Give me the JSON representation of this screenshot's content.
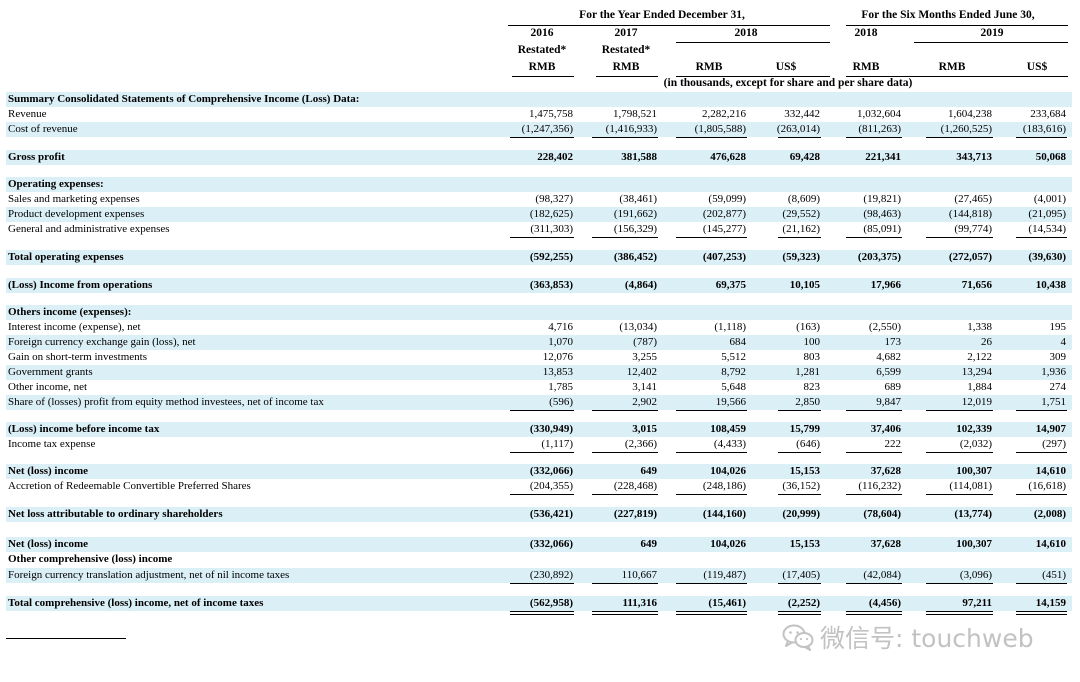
{
  "header": {
    "year_group": "For the Year Ended December 31,",
    "six_month_group": "For the Six Months Ended June 30,",
    "years": [
      "2016",
      "2017",
      "2018",
      "2018",
      "2019"
    ],
    "restated": [
      "Restated*",
      "Restated*"
    ],
    "currencies": [
      "RMB",
      "RMB",
      "RMB",
      "US$",
      "RMB",
      "RMB",
      "US$"
    ],
    "units_note": "(in thousands, except for share and per share data)"
  },
  "rows": [
    {
      "label": "Summary Consolidated Statements of Comprehensive Income (Loss) Data:",
      "values": [
        "",
        "",
        "",
        "",
        "",
        "",
        ""
      ]
    },
    {
      "label": "Revenue",
      "values": [
        "1,475,758",
        "1,798,521",
        "2,282,216",
        "332,442",
        "1,032,604",
        "1,604,238",
        "233,684"
      ]
    },
    {
      "label": "Cost of revenue",
      "values": [
        "(1,247,356)",
        "(1,416,933)",
        "(1,805,588)",
        "(263,014)",
        "(811,263)",
        "(1,260,525)",
        "(183,616)"
      ]
    },
    {
      "label": "Gross profit",
      "values": [
        "228,402",
        "381,588",
        "476,628",
        "69,428",
        "221,341",
        "343,713",
        "50,068"
      ]
    },
    {
      "label": "Operating expenses:",
      "values": [
        "",
        "",
        "",
        "",
        "",
        "",
        ""
      ]
    },
    {
      "label": "Sales and marketing expenses",
      "values": [
        "(98,327)",
        "(38,461)",
        "(59,099)",
        "(8,609)",
        "(19,821)",
        "(27,465)",
        "(4,001)"
      ]
    },
    {
      "label": "Product development expenses",
      "values": [
        "(182,625)",
        "(191,662)",
        "(202,877)",
        "(29,552)",
        "(98,463)",
        "(144,818)",
        "(21,095)"
      ]
    },
    {
      "label": "General and administrative expenses",
      "values": [
        "(311,303)",
        "(156,329)",
        "(145,277)",
        "(21,162)",
        "(85,091)",
        "(99,774)",
        "(14,534)"
      ]
    },
    {
      "label": "Total operating expenses",
      "values": [
        "(592,255)",
        "(386,452)",
        "(407,253)",
        "(59,323)",
        "(203,375)",
        "(272,057)",
        "(39,630)"
      ]
    },
    {
      "label": "(Loss) Income from operations",
      "values": [
        "(363,853)",
        "(4,864)",
        "69,375",
        "10,105",
        "17,966",
        "71,656",
        "10,438"
      ]
    },
    {
      "label": "Others income (expenses):",
      "values": [
        "",
        "",
        "",
        "",
        "",
        "",
        ""
      ]
    },
    {
      "label": "Interest income (expense), net",
      "values": [
        "4,716",
        "(13,034)",
        "(1,118)",
        "(163)",
        "(2,550)",
        "1,338",
        "195"
      ]
    },
    {
      "label": "Foreign currency exchange gain (loss), net",
      "values": [
        "1,070",
        "(787)",
        "684",
        "100",
        "173",
        "26",
        "4"
      ]
    },
    {
      "label": "Gain on short-term investments",
      "values": [
        "12,076",
        "3,255",
        "5,512",
        "803",
        "4,682",
        "2,122",
        "309"
      ]
    },
    {
      "label": "Government grants",
      "values": [
        "13,853",
        "12,402",
        "8,792",
        "1,281",
        "6,599",
        "13,294",
        "1,936"
      ]
    },
    {
      "label": "Other income, net",
      "values": [
        "1,785",
        "3,141",
        "5,648",
        "823",
        "689",
        "1,884",
        "274"
      ]
    },
    {
      "label": "Share of (losses) profit from equity method investees, net of income tax",
      "values": [
        "(596)",
        "2,902",
        "19,566",
        "2,850",
        "9,847",
        "12,019",
        "1,751"
      ]
    },
    {
      "label": "(Loss) income before income tax",
      "values": [
        "(330,949)",
        "3,015",
        "108,459",
        "15,799",
        "37,406",
        "102,339",
        "14,907"
      ]
    },
    {
      "label": "Income tax expense",
      "values": [
        "(1,117)",
        "(2,366)",
        "(4,433)",
        "(646)",
        "222",
        "(2,032)",
        "(297)"
      ]
    },
    {
      "label": "Net (loss) income",
      "values": [
        "(332,066)",
        "649",
        "104,026",
        "15,153",
        "37,628",
        "100,307",
        "14,610"
      ]
    },
    {
      "label": "Accretion of Redeemable Convertible Preferred Shares",
      "values": [
        "(204,355)",
        "(228,468)",
        "(248,186)",
        "(36,152)",
        "(116,232)",
        "(114,081)",
        "(16,618)"
      ]
    },
    {
      "label": "Net loss attributable to ordinary shareholders",
      "values": [
        "(536,421)",
        "(227,819)",
        "(144,160)",
        "(20,999)",
        "(78,604)",
        "(13,774)",
        "(2,008)"
      ]
    },
    {
      "label": "Net (loss) income",
      "values": [
        "(332,066)",
        "649",
        "104,026",
        "15,153",
        "37,628",
        "100,307",
        "14,610"
      ]
    },
    {
      "label": "Other comprehensive (loss) income",
      "values": [
        "",
        "",
        "",
        "",
        "",
        "",
        ""
      ]
    },
    {
      "label": "Foreign currency translation adjustment, net of nil income taxes",
      "values": [
        "(230,892)",
        "110,667",
        "(119,487)",
        "(17,405)",
        "(42,084)",
        "(3,096)",
        "(451)"
      ]
    },
    {
      "label": "Total comprehensive (loss) income, net of income taxes",
      "values": [
        "(562,958)",
        "111,316",
        "(15,461)",
        "(2,252)",
        "(4,456)",
        "97,211",
        "14,159"
      ]
    }
  ],
  "watermark": {
    "icon": "wechat-icon",
    "text": "微信号: touchweb"
  }
}
